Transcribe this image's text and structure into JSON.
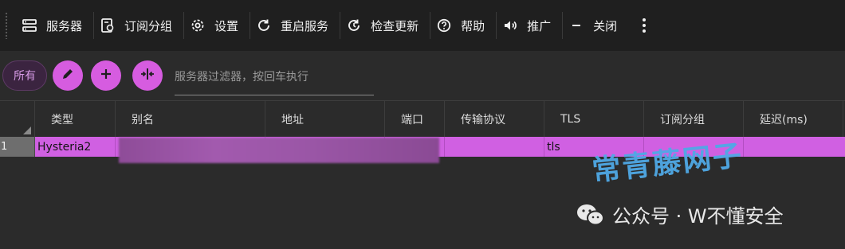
{
  "toolbar": {
    "items": [
      {
        "label": "服务器",
        "icon": "server-icon"
      },
      {
        "label": "订阅分组",
        "icon": "subscription-icon"
      },
      {
        "label": "设置",
        "icon": "gear-icon"
      },
      {
        "label": "重启服务",
        "icon": "restart-icon"
      },
      {
        "label": "检查更新",
        "icon": "update-icon"
      },
      {
        "label": "帮助",
        "icon": "help-icon"
      },
      {
        "label": "推广",
        "icon": "speaker-icon"
      },
      {
        "label": "关闭",
        "icon": "minus-icon"
      }
    ],
    "more_icon": "more-vertical-icon"
  },
  "filter": {
    "all_label": "所有",
    "placeholder": "服务器过滤器，按回车执行",
    "value": ""
  },
  "table": {
    "headers": [
      "类型",
      "别名",
      "地址",
      "端口",
      "传输协议",
      "TLS",
      "订阅分组",
      "延迟(ms)"
    ],
    "rows": [
      {
        "index": "1",
        "type": "Hysteria2",
        "alias": "",
        "address": "",
        "port": "",
        "transport": "",
        "tls": "tls",
        "group": "",
        "latency": ""
      }
    ]
  },
  "overlay": {
    "watermark": "常青藤网子",
    "wechat_label": "公众号 · W不懂安全"
  },
  "colors": {
    "accent": "#d65ce0",
    "selected_row": "#d060e2",
    "toolbar_bg": "#1f1f1f",
    "page_bg": "#2b2b2b"
  }
}
